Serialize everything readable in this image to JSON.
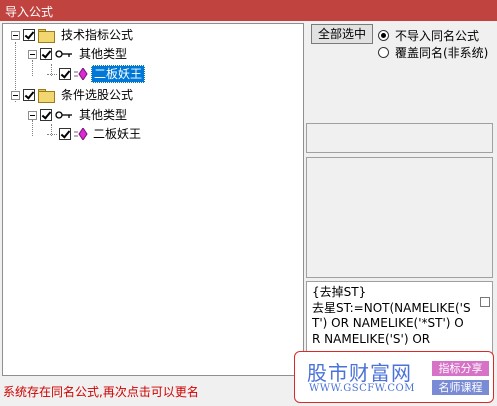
{
  "window": {
    "title": "导入公式"
  },
  "tree": {
    "items": [
      {
        "label": "技术指标公式"
      },
      {
        "label": "其他类型"
      },
      {
        "label": "二板妖王"
      },
      {
        "label": "条件选股公式"
      },
      {
        "label": "其他类型"
      },
      {
        "label": "二板妖王"
      }
    ]
  },
  "options": {
    "select_all_label": "全部选中",
    "radios": [
      {
        "label": "不导入同名公式",
        "checked": true
      },
      {
        "label": "覆盖同名(非系统)",
        "checked": false
      }
    ]
  },
  "code": {
    "text": "{去掉ST}\n去星ST:=NOT(NAMELIKE('ST') OR NAMELIKE('*ST') OR NAMELIKE('S') OR"
  },
  "status": {
    "message": "系统存在同名公式,再次点击可以更名"
  },
  "watermark": {
    "brand": "股市财富网",
    "url": "WWW.GSCFW.COM",
    "badge1": "指标分享",
    "badge2": "名师课程"
  },
  "colors": {
    "titlebar": "#c0433f",
    "selection": "#0078d7",
    "status_text": "#d00000",
    "watermark_border": "#d92a27"
  }
}
